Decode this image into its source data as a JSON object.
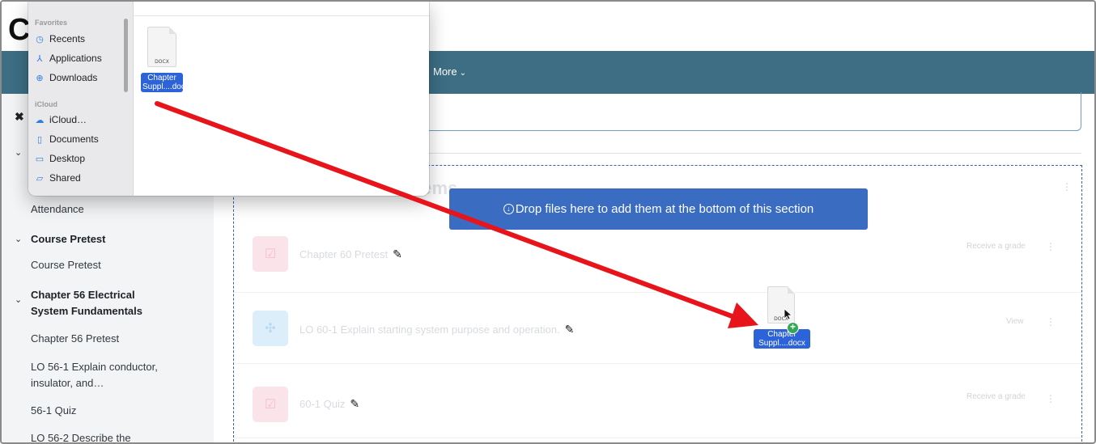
{
  "header": {
    "logo_letter": "C",
    "nav_more_label": "More",
    "nav_more_chevron": "⌄"
  },
  "sidebar": {
    "close_glyph": "✖",
    "items": [
      {
        "label": "Attendance"
      },
      {
        "label": "Course Pretest",
        "section": true
      },
      {
        "label": "Course Pretest"
      },
      {
        "label": "Chapter 56 Electrical System Fundamentals",
        "section": true
      },
      {
        "label": "Chapter 56 Pretest"
      },
      {
        "label": "LO 56-1 Explain conductor, insulator, and..."
      },
      {
        "label": "56-1 Quiz"
      },
      {
        "label": "LO 56-2 Describe the"
      }
    ],
    "line_texts": {
      "attendance": "Attendance",
      "course_pretest_section": "Course Pretest",
      "course_pretest_item": "Course Pretest",
      "ch56_section_line1": "Chapter 56 Electrical",
      "ch56_section_line2": "System Fundamentals",
      "ch56_pretest": "Chapter 56 Pretest",
      "lo561_line1": "LO 56-1 Explain conductor,",
      "lo561_line2": "insulator, and…",
      "quiz561": "56-1 Quiz",
      "lo562": "LO 56-2 Describe the"
    }
  },
  "main": {
    "section_title_fragment": "tems",
    "drop_banner": "Drop files here to add them at the bottom of this section",
    "activities": [
      {
        "name": "Chapter 60 Pretest",
        "meta": "Receive a grade",
        "icon": "quiz-icon"
      },
      {
        "name": "LO 60-1 Explain starting system purpose and operation.",
        "meta": "View",
        "icon": "lesson-icon"
      },
      {
        "name": "60-1 Quiz",
        "meta": "Receive a grade",
        "icon": "quiz-icon"
      }
    ]
  },
  "finder": {
    "favorites_heading": "Favorites",
    "favorites": [
      {
        "label": "Recents",
        "icon": "clock-icon"
      },
      {
        "label": "Applications",
        "icon": "applications-icon"
      },
      {
        "label": "Downloads",
        "icon": "download-icon"
      }
    ],
    "icloud_heading": "iCloud",
    "icloud": [
      {
        "label": "iCloud…",
        "icon": "cloud-icon"
      },
      {
        "label": "Documents",
        "icon": "document-icon"
      },
      {
        "label": "Desktop",
        "icon": "desktop-icon"
      },
      {
        "label": "Shared",
        "icon": "shared-folder-icon"
      }
    ],
    "file": {
      "ext": "DOCX",
      "label_line1": "Chapter",
      "label_line2": "Suppl....docx"
    }
  },
  "drag_ghost": {
    "ext": "DOCX",
    "label_line1": "Chapter",
    "label_line2": "Suppl....docx",
    "badge": "+"
  },
  "colors": {
    "navbar": "#3d6e84",
    "drop_banner": "#3a6cc2",
    "drag_arrow": "#e8141b",
    "finder_selection": "#2d63d8"
  }
}
